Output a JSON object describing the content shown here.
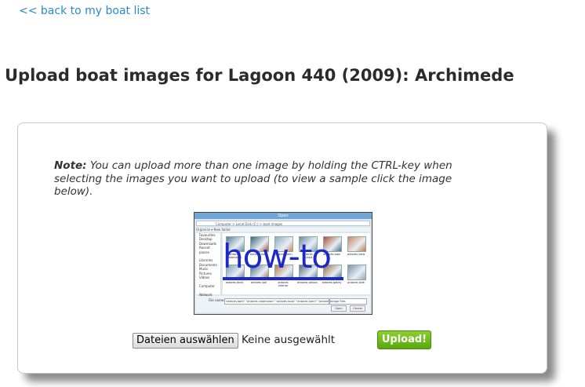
{
  "back_link": "<< back to my boat list",
  "page_title": "Upload boat images for Lagoon 440 (2009): Archimede",
  "note": {
    "label": "Note:",
    "text": " You can upload more than one image by holding the CTRL-key when selecting the images you want to upload (to view a sample click the image below)."
  },
  "sample": {
    "window_title": "Open",
    "address": "Computer > Local Disk (C:) > boat images",
    "toolbar": "Organise ▾   New folder",
    "sidebar": [
      "Favourites",
      "Desktop",
      "Downloads",
      "Recent places",
      "",
      "Libraries",
      "Documents",
      "Music",
      "Pictures",
      "Videos",
      "",
      "Computer",
      "",
      "Network"
    ],
    "thumbs": [
      "antares catamaran",
      "antares boat",
      "antares stern",
      "antares cockpit",
      "antares bow",
      "antares view",
      "antares deck",
      "antares sail",
      "antares interior",
      "antares saloon",
      "antares galley",
      "antares side"
    ],
    "file_name_label": "File name:",
    "file_name_value": "\"antares bath\" \"antares catamaran\" \"antares boat\" \"antares stern\" \"antares cockpit\"",
    "file_type": "Image Files",
    "open_label": "Open",
    "cancel_label": "Cancel",
    "overlay_text": "how-to"
  },
  "file_input": {
    "button_label": "Dateien auswählen",
    "status": "Keine ausgewählt"
  },
  "upload_button": "Upload!"
}
